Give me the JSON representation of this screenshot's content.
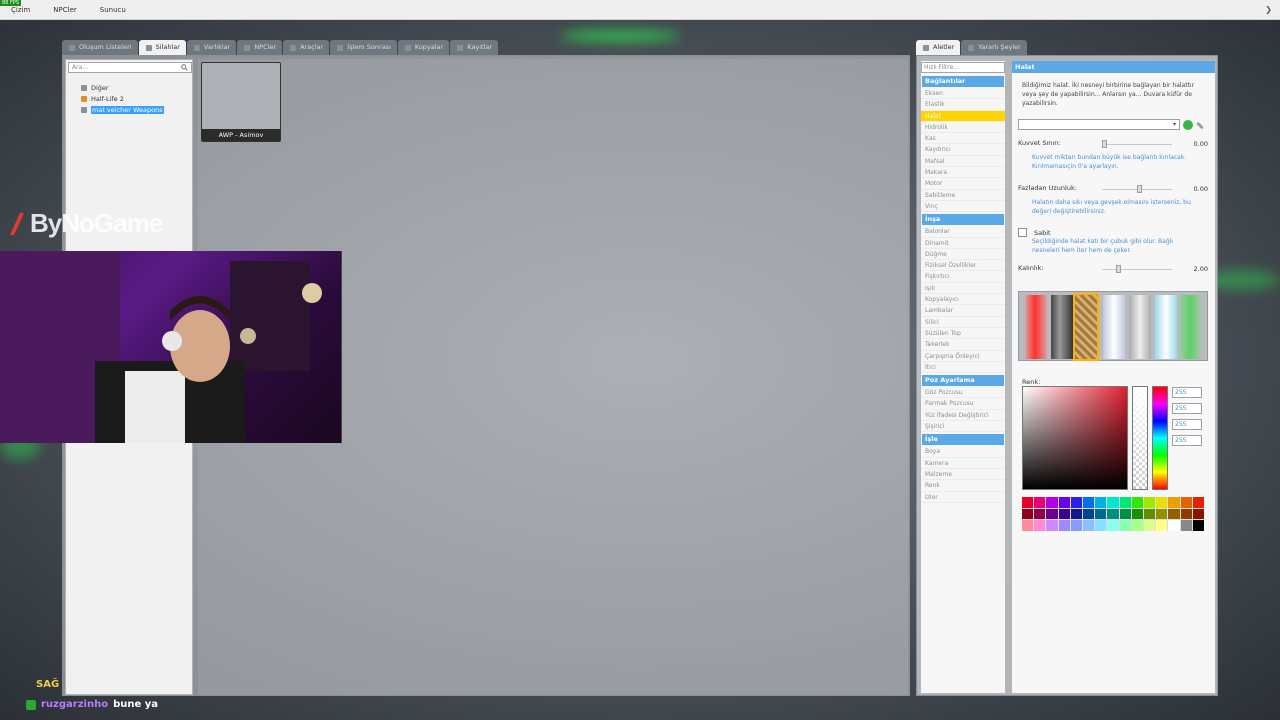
{
  "topbar": {
    "fps": "88 FPS",
    "menu": [
      "Çizim",
      "NPCler",
      "Sunucu"
    ]
  },
  "spawnmenu": {
    "tabs": [
      {
        "label": "Oluşum Listeleri",
        "icon": "list-icon",
        "active": false
      },
      {
        "label": "Silahlar",
        "icon": "gun-icon",
        "active": true
      },
      {
        "label": "Varlıklar",
        "icon": "entity-icon",
        "active": false
      },
      {
        "label": "NPCler",
        "icon": "npc-icon",
        "active": false
      },
      {
        "label": "Araçlar",
        "icon": "car-icon",
        "active": false
      },
      {
        "label": "İşlem Sonrası",
        "icon": "monitor-icon",
        "active": false
      },
      {
        "label": "Kopyalar",
        "icon": "copy-icon",
        "active": false
      },
      {
        "label": "Kayıtlar",
        "icon": "save-icon",
        "active": false
      }
    ],
    "search_placeholder": "Ara...",
    "tree": [
      {
        "label": "Diğer",
        "icon": "gun-icon",
        "selected": false
      },
      {
        "label": "Half-Life 2",
        "icon": "halflife-icon",
        "selected": false
      },
      {
        "label": "mat veicher Weapons",
        "icon": "gun-icon",
        "selected": true
      }
    ],
    "weapons": [
      {
        "label": "AWP - Asimov"
      }
    ]
  },
  "context": {
    "tabs": [
      {
        "label": "Aletler",
        "icon": "wrench-icon",
        "active": true
      },
      {
        "label": "Yararlı Şeyler",
        "icon": "tools-icon",
        "active": false
      }
    ],
    "filter_placeholder": "Hızlı Filtre...",
    "categories": [
      {
        "name": "Bağlantılar",
        "tools": [
          "Eksen",
          "Elastik",
          "Halat",
          "Hidrolik",
          "Kas",
          "Kaydırıcı",
          "Mafsal",
          "Makara",
          "Motor",
          "Sabitleme",
          "Vinç"
        ]
      },
      {
        "name": "İnşa",
        "tools": [
          "Balonlar",
          "Dinamit",
          "Düğme",
          "Fiziksel Özellikler",
          "Fişkırtıcı",
          "Işık",
          "Kopyalayıcı",
          "Lambalar",
          "Silici",
          "Süzülen Top",
          "Tekerlek",
          "Çarpışma Önleyici",
          "İtici"
        ]
      },
      {
        "name": "Poz Ayarlama",
        "tools": [
          "Göz Pozcusu",
          "Parmak Pozcusu",
          "Yüz İfadesi Değiştirici",
          "Şişirici"
        ]
      },
      {
        "name": "İşle",
        "tools": [
          "Boya",
          "Kamera",
          "Malzeme",
          "Renk",
          "İzler"
        ]
      }
    ],
    "active_tool": "Halat",
    "panel_title": "Halat",
    "description": "Bildiğimiz halat. İki nesneyi birbirine bağlayan bir halattır veya şey de yapabilirsin... Anlarsın ya... Duvara küfür de yazabilirsin.",
    "sliders": [
      {
        "label": "Kuvvet Sınırı:",
        "value": "0.00",
        "fraction": 0.0,
        "help": "Kuvvet miktarı bundan büyük ise bağlantı kırılacak. Kırılmamasıçin 0'a ayarlayın."
      },
      {
        "label": "Fazladan Uzunluk:",
        "value": "0.00",
        "fraction": 0.5,
        "help": "Halatın daha sıkı veya gevşek olmasını isterseniz, bu değeri değiştirebilirsiniz."
      },
      {
        "label": "Kalınlık:",
        "value": "2.00",
        "fraction": 0.2,
        "help": ""
      }
    ],
    "rigid": {
      "label": "Sabit",
      "help": "Seçildiğinde halat katı bir çubuk gibi olur. Bağlı nesneleri hem iter hem de çeker."
    },
    "color_label": "Renk:",
    "rgba": [
      "255",
      "255",
      "255",
      "255"
    ]
  },
  "overlay": {
    "logo": "ByNoGame",
    "chat_prefix": "SAĞ",
    "chat_name": "ruzgarzinho",
    "chat_message": "bune ya"
  },
  "colors": {
    "accent": "#5aa8e6",
    "active_tool": "#ffd400",
    "selection": "#3aa0ff"
  }
}
